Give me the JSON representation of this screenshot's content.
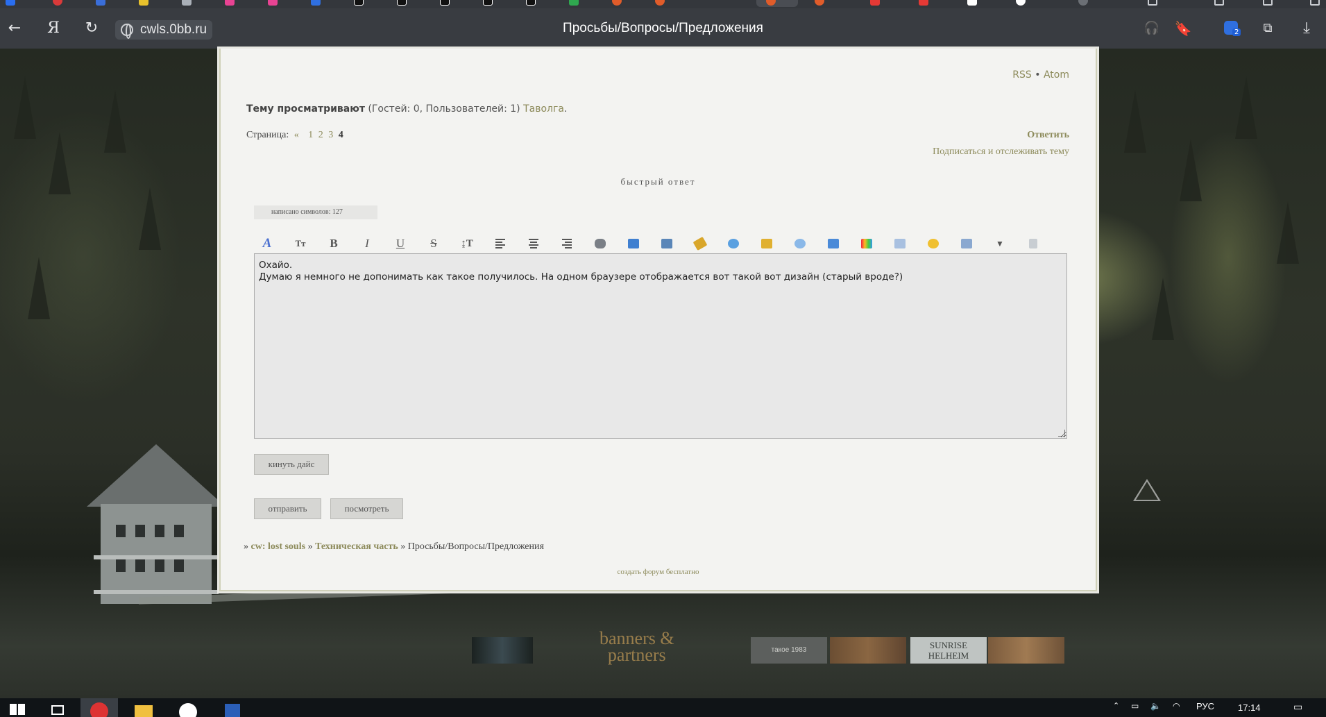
{
  "browser": {
    "url": "cwls.0bb.ru",
    "title": "Просьбы/Вопросы/Предложения",
    "notification_count": "2",
    "tab_favicon_colors": [
      "#2a6ef0",
      "#d93a3a",
      "#3a6ed9",
      "#e8c12c",
      "#e84393",
      "#2f6fe0",
      "#111111",
      "#111111",
      "#111111",
      "#2fa84f",
      "#e05c2a",
      "#e05c2a",
      "#e05c2a",
      "#e05c2a",
      "#e53935",
      "#e53935",
      "#ffffff",
      "#ffffff"
    ]
  },
  "forum": {
    "feeds": {
      "rss": "RSS",
      "separator": "•",
      "atom": "Atom"
    },
    "viewers": {
      "label": "Тему просматривают",
      "counts": "(Гостей: 0, Пользователей: 1)",
      "user": "Таволга",
      "end": "."
    },
    "pagination": {
      "label": "Страница:",
      "prev": "«",
      "pages": [
        "1",
        "2",
        "3"
      ],
      "current": "4"
    },
    "reply_link": "Ответить",
    "subscribe_link": "Подписаться и отслеживать тему",
    "quick_reply_title": "быстрый ответ",
    "char_count": "написано символов: 127",
    "editor": {
      "line1": "Охайо.",
      "line2": "Думаю я немного не допонимать как такое получилось. На одном браузере отображается вот такой вот дизайн (старый вроде?)"
    },
    "buttons": {
      "dice": "кинуть дайс",
      "submit": "отправить",
      "preview": "посмотреть"
    },
    "breadcrumbs": {
      "sep": "»",
      "forum_name": "cw: lost souls",
      "section": "Техническая часть",
      "topic": "Просьбы/Вопросы/Предложения"
    },
    "create_forum": "создать форум бесплатно"
  },
  "banners": {
    "title_line1": "banners &",
    "title_line2": "partners",
    "sunrise": "SUNRISE",
    "helheim": "HELHEIM",
    "small": "такое 1983"
  },
  "taskbar": {
    "lang": "РУС",
    "time": "17:14"
  },
  "colors": {
    "link": "#8c8a5a",
    "panel": "#f3f3f1",
    "editor_bg": "#e8e8e8",
    "button": "#d6d6d3"
  }
}
